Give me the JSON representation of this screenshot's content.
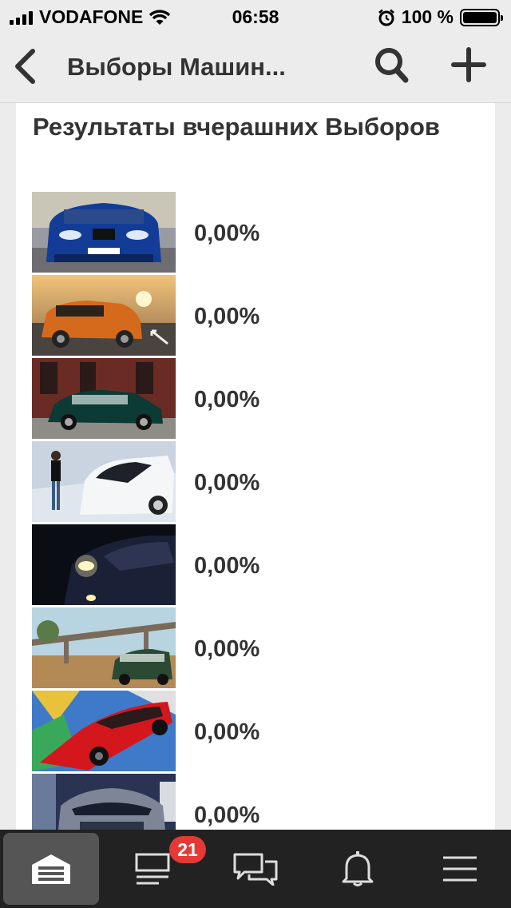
{
  "status_bar": {
    "carrier": "VODAFONE",
    "time": "06:58",
    "battery": "100 %",
    "battery_level": 1.0
  },
  "nav": {
    "title": "Выборы Машин...",
    "back_icon": "chevron-left-icon",
    "search_icon": "search-icon",
    "add_icon": "plus-icon"
  },
  "content": {
    "heading": "Результаты вчерашних Выборов",
    "results": [
      {
        "percent": "0,00%",
        "photo": "blue-sedan-front"
      },
      {
        "percent": "0,00%",
        "photo": "orange-suv-sunset"
      },
      {
        "percent": "0,00%",
        "photo": "dark-green-sedan"
      },
      {
        "percent": "0,00%",
        "photo": "white-hatchback-snow"
      },
      {
        "percent": "0,00%",
        "photo": "dark-car-headlights"
      },
      {
        "percent": "0,00%",
        "photo": "green-car-bridge"
      },
      {
        "percent": "0,00%",
        "photo": "red-car-graffiti"
      },
      {
        "percent": "0,00%",
        "photo": "grey-car-night"
      }
    ]
  },
  "tab_bar": {
    "tabs": [
      {
        "icon": "garage-icon",
        "active": true
      },
      {
        "icon": "feed-icon",
        "badge": "21"
      },
      {
        "icon": "chat-icon"
      },
      {
        "icon": "bell-icon"
      },
      {
        "icon": "menu-icon"
      }
    ]
  },
  "colors": {
    "background": "#ececec",
    "text": "#333333",
    "tabbar": "#222222",
    "badge": "#e53935"
  }
}
